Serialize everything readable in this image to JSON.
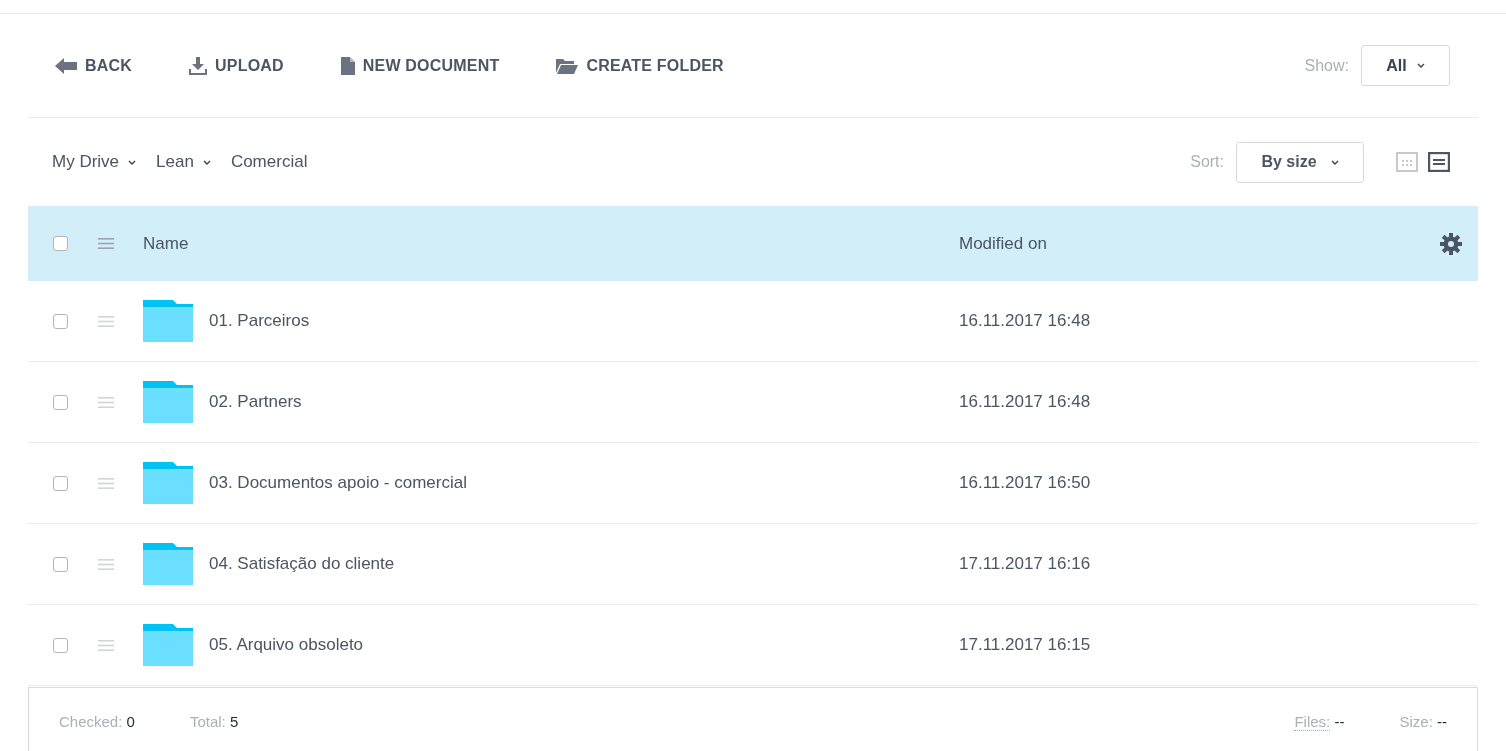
{
  "toolbar": {
    "actions": [
      {
        "kind": "back",
        "label": "BACK"
      },
      {
        "kind": "upload",
        "label": "UPLOAD"
      },
      {
        "kind": "document",
        "label": "NEW DOCUMENT"
      },
      {
        "kind": "folder",
        "label": "CREATE FOLDER"
      }
    ],
    "show": {
      "label": "Show:",
      "value": "All"
    }
  },
  "breadcrumbs": [
    {
      "label": "My Drive",
      "dropdown": true
    },
    {
      "label": "Lean",
      "dropdown": true
    },
    {
      "label": "Comercial",
      "dropdown": false
    }
  ],
  "sort": {
    "label": "Sort:",
    "value": "By size"
  },
  "view_modes": [
    {
      "kind": "grid",
      "selected": false
    },
    {
      "kind": "list",
      "selected": true
    }
  ],
  "table": {
    "columns": [
      "Name",
      "Modified on"
    ],
    "header_checked": false,
    "rows": [
      {
        "name": "01. Parceiros",
        "modified": "16.11.2017 16:48",
        "checked": false
      },
      {
        "name": "02. Partners",
        "modified": "16.11.2017 16:48",
        "checked": false
      },
      {
        "name": "03. Documentos apoio - comercial",
        "modified": "16.11.2017 16:50",
        "checked": false
      },
      {
        "name": "04. Satisfação do cliente",
        "modified": "17.11.2017 16:16",
        "checked": false
      },
      {
        "name": "05. Arquivo obsoleto",
        "modified": "17.11.2017 16:15",
        "checked": false
      }
    ]
  },
  "status_bar": {
    "checked": {
      "label": "Checked:",
      "value": "0"
    },
    "total": {
      "label": "Total:",
      "value": "5"
    },
    "files": {
      "label": "Files:",
      "value": "--"
    },
    "size": {
      "label": "Size:",
      "value": "--"
    }
  }
}
